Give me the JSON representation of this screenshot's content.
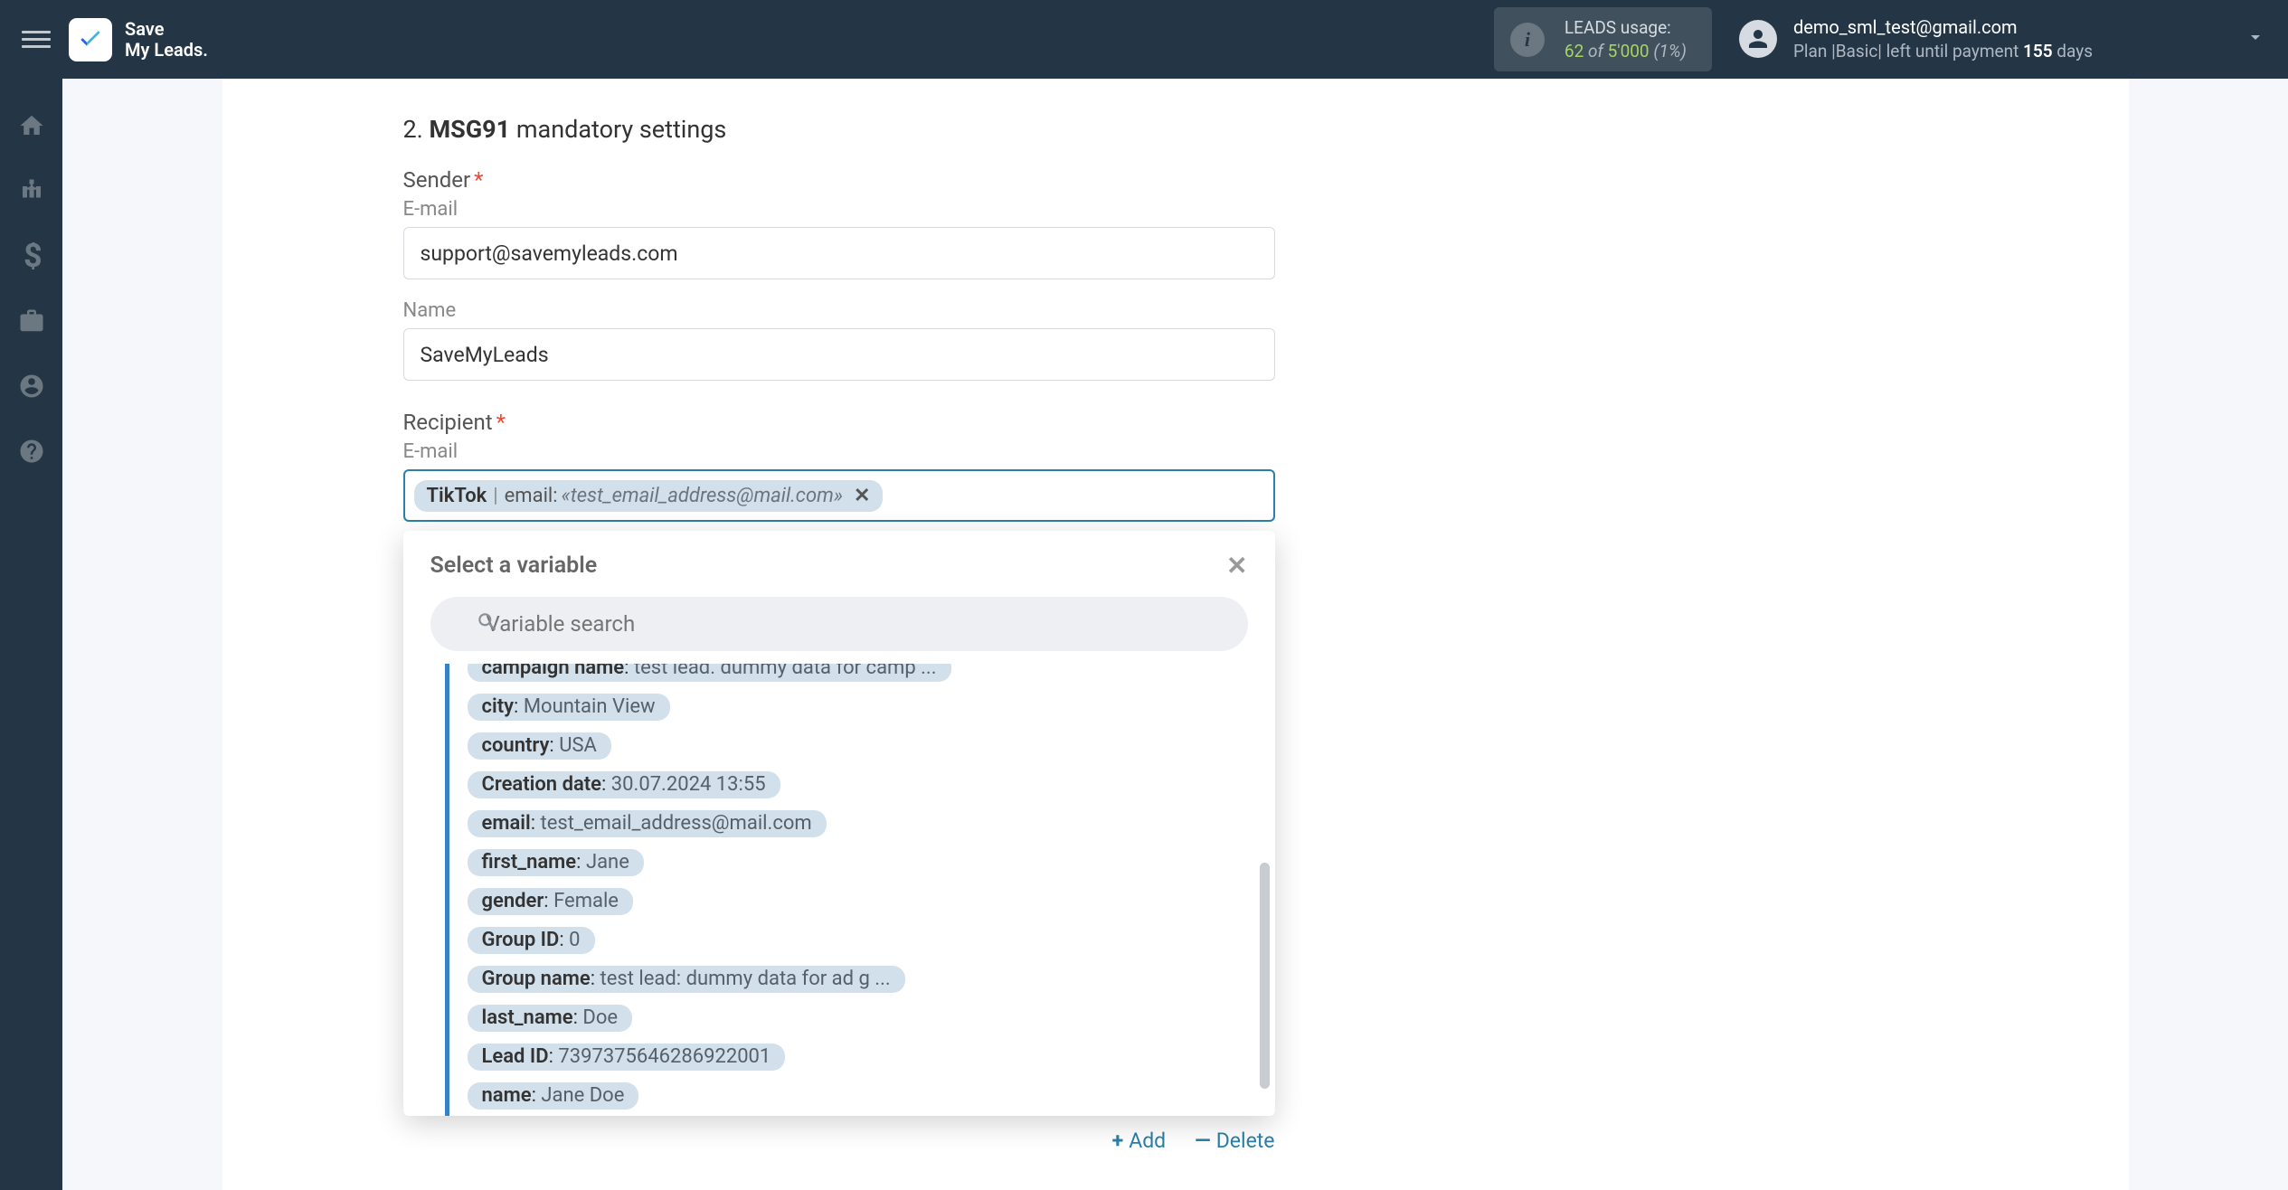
{
  "header": {
    "logo_line1": "Save",
    "logo_line2": "My Leads.",
    "usage_label": "LEADS usage:",
    "usage_current": "62",
    "usage_of": "of",
    "usage_max": "5'000",
    "usage_pct": "(1%)",
    "account_email": "demo_sml_test@gmail.com",
    "plan_prefix": "Plan |Basic| left until payment ",
    "plan_days": "155",
    "plan_suffix": " days"
  },
  "section": {
    "number": "2.",
    "bold": "MSG91",
    "rest": " mandatory settings"
  },
  "sender": {
    "label": "Sender",
    "email_label": "E-mail",
    "email_value": "support@savemyleads.com",
    "name_label": "Name",
    "name_value": "SaveMyLeads"
  },
  "recipient": {
    "label": "Recipient",
    "email_label": "E-mail",
    "chip_source": "TikTok",
    "chip_field": "email:",
    "chip_value": "«test_email_address@mail.com»"
  },
  "dropdown": {
    "title": "Select a variable",
    "search_placeholder": "Variable search",
    "variables": [
      {
        "key": "campaign name",
        "value": "test lead. dummy data for camp ...",
        "truncated_top": true
      },
      {
        "key": "city",
        "value": "Mountain View"
      },
      {
        "key": "country",
        "value": "USA"
      },
      {
        "key": "Creation date",
        "value": "30.07.2024 13:55"
      },
      {
        "key": "email",
        "value": "test_email_address@mail.com"
      },
      {
        "key": "first_name",
        "value": "Jane"
      },
      {
        "key": "gender",
        "value": "Female"
      },
      {
        "key": "Group ID",
        "value": "0"
      },
      {
        "key": "Group name",
        "value": "test lead: dummy data for ad g ..."
      },
      {
        "key": "last_name",
        "value": "Doe"
      },
      {
        "key": "Lead ID",
        "value": "7397375646286922001"
      },
      {
        "key": "name",
        "value": "Jane Doe"
      }
    ]
  },
  "actions": {
    "add": "Add",
    "delete": "Delete"
  }
}
